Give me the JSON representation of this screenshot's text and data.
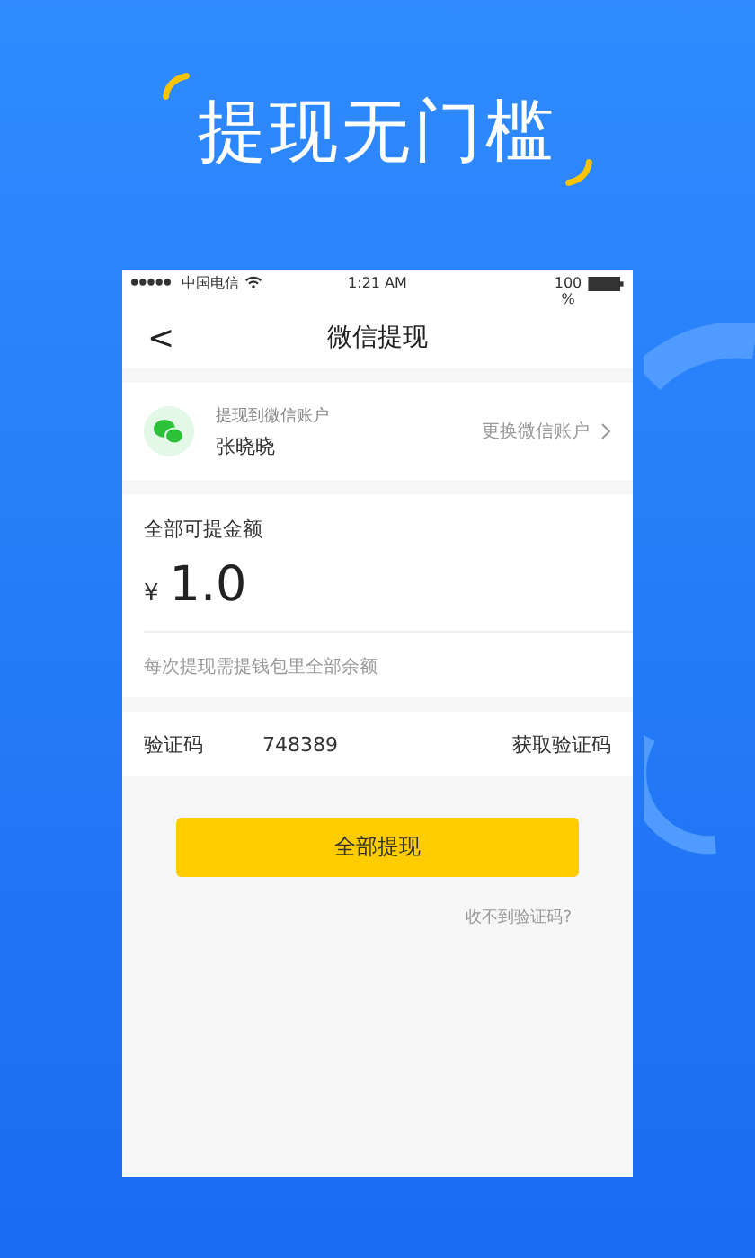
{
  "headline": "提现无门槛",
  "status_bar": {
    "carrier": "中国电信",
    "time": "1:21 AM",
    "battery": "100 %"
  },
  "nav": {
    "back": "<",
    "title": "微信提现"
  },
  "account": {
    "label": "提现到微信账户",
    "name": "张晓晓",
    "change": "更换微信账户"
  },
  "amount": {
    "label": "全部可提金额",
    "currency": "¥",
    "value": "1.0",
    "note": "每次提现需提钱包里全部余额"
  },
  "code_field": {
    "label": "验证码",
    "value": "748389",
    "action": "获取验证码"
  },
  "submit_button": "全部提现",
  "help_link": "收不到验证码?"
}
